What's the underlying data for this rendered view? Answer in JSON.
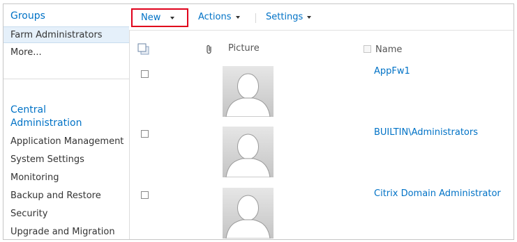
{
  "nav": {
    "groups_heading": "Groups",
    "groups_items": [
      "Farm Administrators",
      "More..."
    ],
    "central_admin_heading_line1": "Central",
    "central_admin_heading_line2": "Administration",
    "central_admin_items": [
      "Application Management",
      "System Settings",
      "Monitoring",
      "Backup and Restore",
      "Security",
      "Upgrade and Migration"
    ]
  },
  "toolbar": {
    "new_label": "New",
    "actions_label": "Actions",
    "settings_label": "Settings"
  },
  "list": {
    "columns": {
      "picture": "Picture",
      "name": "Name"
    },
    "rows": [
      {
        "name": "AppFw1"
      },
      {
        "name": "BUILTIN\\Administrators"
      },
      {
        "name": "Citrix Domain Administrator"
      }
    ]
  },
  "colors": {
    "link": "#0072c6",
    "highlight_box": "#e0001b",
    "selected_bg": "#e5f0fa"
  }
}
